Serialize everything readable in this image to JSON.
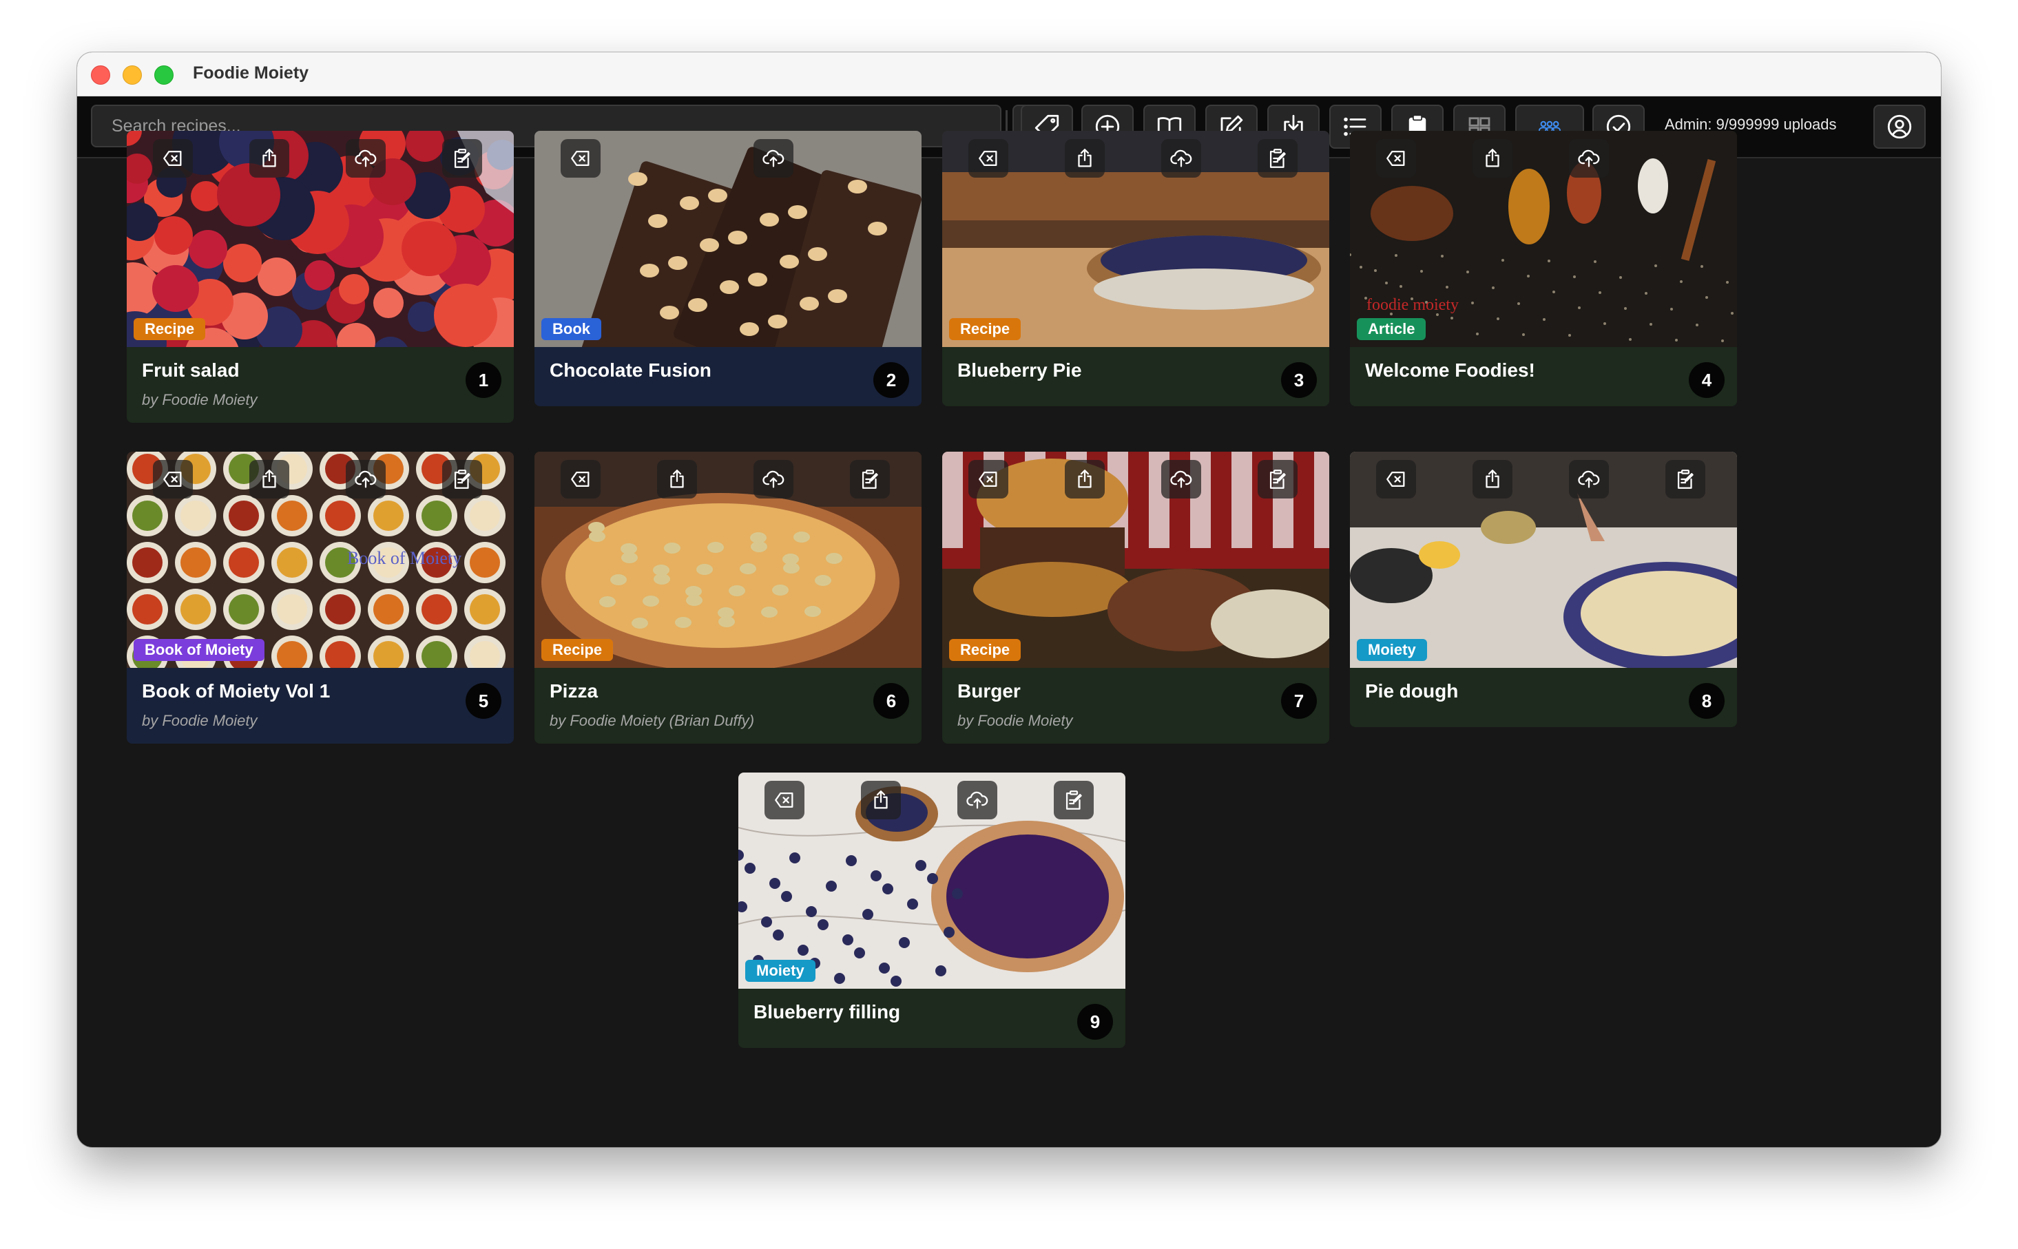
{
  "window": {
    "title": "Foodie Moiety"
  },
  "toolbar": {
    "search_placeholder": "Search recipes...",
    "buttons": [
      {
        "name": "microphone-button",
        "icon": "microphone-icon"
      },
      {
        "name": "tag-button",
        "icon": "tag-icon"
      },
      {
        "name": "add-button",
        "icon": "plus-circle-icon"
      },
      {
        "name": "book-button",
        "icon": "book-open-icon"
      },
      {
        "name": "edit-button",
        "icon": "edit-icon"
      },
      {
        "name": "import-button",
        "icon": "download-icon"
      },
      {
        "name": "list-view-button",
        "icon": "list-icon"
      },
      {
        "name": "clipboard-button",
        "icon": "clipboard-icon"
      },
      {
        "name": "grid-view-button",
        "icon": "grid-icon"
      },
      {
        "name": "users-button",
        "icon": "users-icon"
      },
      {
        "name": "select-button",
        "icon": "check-circle-icon"
      },
      {
        "name": "account-button",
        "icon": "user-circle-icon"
      }
    ],
    "admin_status": "Admin: 9/999999 uploads"
  },
  "cards": [
    {
      "title": "Fruit salad",
      "author": "by Foodie Moiety",
      "type": "Recipe",
      "number": "1",
      "theme": "fruit"
    },
    {
      "title": "Chocolate Fusion",
      "author": "",
      "type": "Book",
      "number": "2",
      "theme": "chocolate"
    },
    {
      "title": "Blueberry Pie",
      "author": "",
      "type": "Recipe",
      "number": "3",
      "theme": "pie"
    },
    {
      "title": "Welcome Foodies!",
      "author": "",
      "type": "Article",
      "number": "4",
      "theme": "spices",
      "image_text": "foodie moiety"
    },
    {
      "title": "Book of Moiety Vol 1",
      "author": "by Foodie Moiety",
      "type": "Book of Moiety",
      "number": "5",
      "theme": "dishes",
      "image_text": "Book of Moiety"
    },
    {
      "title": "Pizza",
      "author": "by Foodie Moiety (Brian Duffy)",
      "type": "Recipe",
      "number": "6",
      "theme": "pizza"
    },
    {
      "title": "Burger",
      "author": "by Foodie Moiety",
      "type": "Recipe",
      "number": "7",
      "theme": "burger"
    },
    {
      "title": "Pie dough",
      "author": "",
      "type": "Moiety",
      "number": "8",
      "theme": "dough"
    },
    {
      "title": "Blueberry filling",
      "author": "",
      "type": "Moiety",
      "number": "9",
      "theme": "filling"
    }
  ],
  "colors": {
    "recipe_badge": "#d9760b",
    "book_badge": "#2a62d8",
    "article_badge": "#17915a",
    "book_of_moiety_badge": "#7b3ddb",
    "moiety_badge": "#1599c7",
    "card_green": "#1d2a1d",
    "card_blue": "#18223a"
  }
}
